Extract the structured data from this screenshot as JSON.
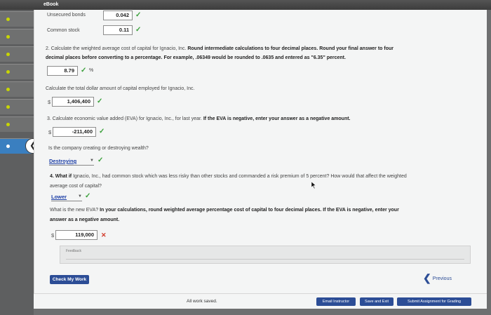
{
  "app": {
    "tab_label": "eBook"
  },
  "answers": {
    "unsecured_bonds": {
      "label": "Unsecured bonds",
      "value": "0.042"
    },
    "common_stock": {
      "label": "Common stock",
      "value": "0.11"
    }
  },
  "q2": {
    "prompt_normal": "2. Calculate the weighted average cost of capital for Ignacio, Inc. ",
    "prompt_bold_1": "Round intermediate calculations to four decimal places. Round your final answer to four",
    "prompt_bold_2": "decimal places before converting to a percentage. For example, .06349 would be rounded to .0635 and entered as \"6.35\" percent.",
    "wacc_value": "8.79",
    "wacc_unit": "%",
    "total_capital_prompt": "Calculate the total dollar amount of capital employed for Ignacio, Inc.",
    "currency": "$",
    "total_capital_value": "1,406,400"
  },
  "q3": {
    "prompt_normal": "3. Calculate economic value added (EVA) for Ignacio, Inc., for last year. ",
    "prompt_bold": "If the EVA is negative, enter your answer as a negative amount.",
    "currency": "$",
    "eva_value": "-211,400",
    "wealth_prompt": "Is the company creating or destroying wealth?",
    "wealth_selected": "Destroying"
  },
  "q4": {
    "prompt_line1_a": "4. What if ",
    "prompt_line1_b": "Ignacio, Inc., had common stock which was less risky than other stocks and commanded a risk premium of 5 percent? How would that affect the weighted",
    "prompt_line2": "average cost of capital?",
    "effect_selected": "Lower",
    "new_eva_prompt": "What is the new EVA? ",
    "new_eva_bold_1": "In your calculations, round weighted average percentage cost of capital to four decimal places. If the EVA is negative, enter your",
    "new_eva_bold_2": "answer as a negative amount.",
    "currency": "$",
    "new_eva_value": "119,000"
  },
  "feedback": {
    "label": "Feedback"
  },
  "buttons": {
    "check_my_work": "Check My Work",
    "previous": "Previous",
    "email_instructor": "Email Instructor",
    "save_and_exit": "Save and Exit",
    "submit": "Submit Assignment for Grading"
  },
  "status": {
    "saved": "All work saved."
  },
  "colors": {
    "correct": "#3aa03a",
    "incorrect": "#d23a2a",
    "primary": "#2c4d96",
    "sidebar_active": "#3a7fc0"
  }
}
